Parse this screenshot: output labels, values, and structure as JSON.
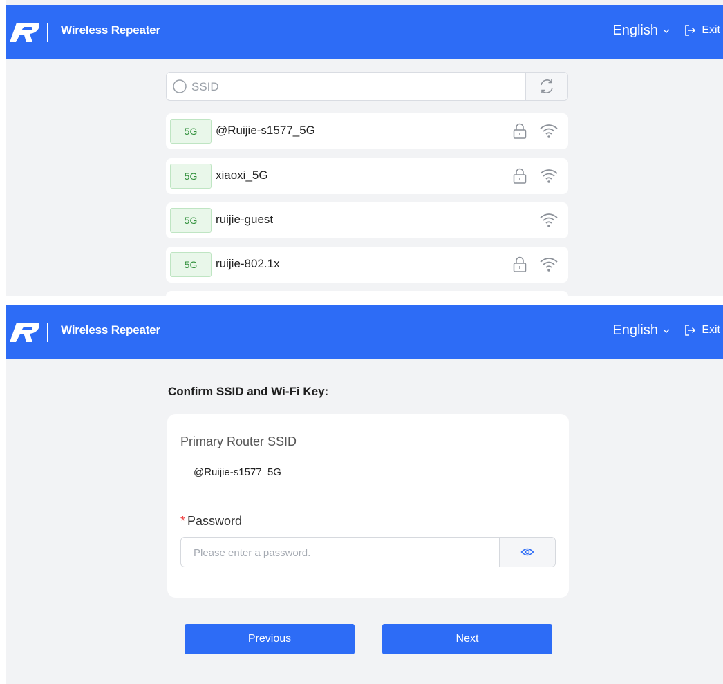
{
  "colors": {
    "primary": "#2d6cf6",
    "background": "#f2f3f5",
    "band_bg": "#e9f7ea",
    "band_text": "#2f8f3a",
    "required": "#f04848"
  },
  "header": {
    "title": "Wireless Repeater",
    "language": "English",
    "exit_label": "Exit",
    "logo_icon": "ruijie-r-logo",
    "lang_icon": "chevron-down-icon",
    "exit_icon": "exit-icon"
  },
  "search": {
    "placeholder": "SSID",
    "icon": "search-icon",
    "refresh_icon": "refresh-icon"
  },
  "networks": [
    {
      "band": "5G",
      "ssid": "@Ruijie-s1577_5G",
      "locked": true
    },
    {
      "band": "5G",
      "ssid": "xiaoxi_5G",
      "locked": true
    },
    {
      "band": "5G",
      "ssid": "ruijie-guest",
      "locked": false
    },
    {
      "band": "5G",
      "ssid": "ruijie-802.1x",
      "locked": true
    }
  ],
  "confirm": {
    "title": "Confirm SSID and Wi-Fi Key:",
    "ssid_label": "Primary Router SSID",
    "ssid_value": "@Ruijie-s1577_5G",
    "password_required_mark": "*",
    "password_label": "Password",
    "password_placeholder": "Please enter a password.",
    "eye_icon": "eye-icon"
  },
  "buttons": {
    "previous": "Previous",
    "next": "Next"
  }
}
